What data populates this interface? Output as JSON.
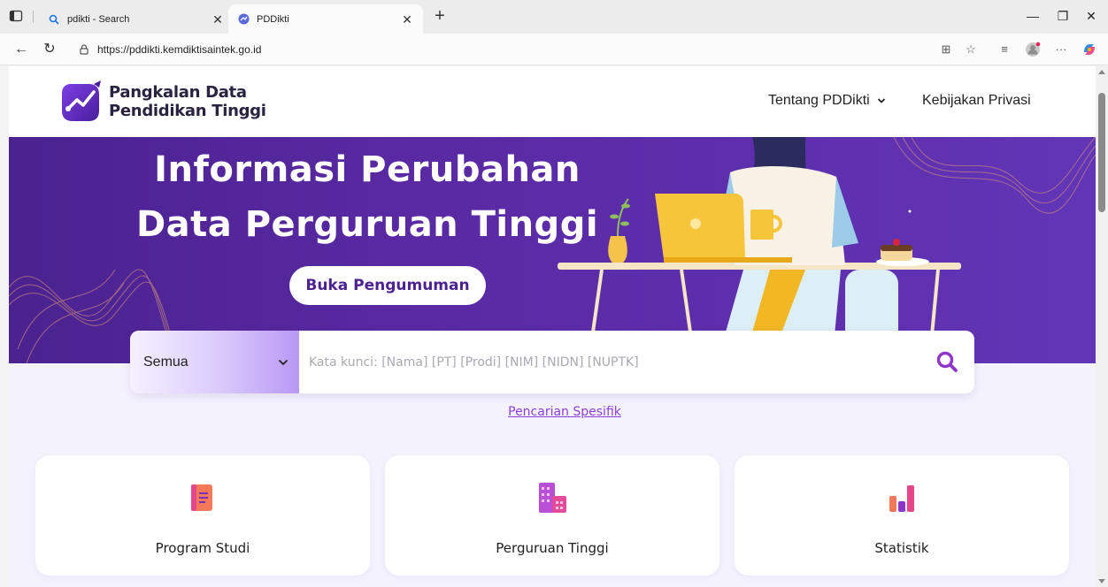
{
  "browser": {
    "tabs": [
      {
        "title": "pdikti - Search"
      },
      {
        "title": "PDDikti"
      }
    ],
    "url": "https://pddikti.kemdiktisaintek.go.id"
  },
  "header": {
    "logo_line1": "Pangkalan Data",
    "logo_line2": "Pendidikan Tinggi",
    "nav": [
      {
        "label": "Tentang PDDikti"
      },
      {
        "label": "Kebijakan Privasi"
      }
    ]
  },
  "hero": {
    "title_line1": "Informasi Perubahan",
    "title_line2": "Data Perguruan Tinggi",
    "button_label": "Buka Pengumuman"
  },
  "search": {
    "category": "Semua",
    "placeholder": "Kata kunci: [Nama] [PT] [Prodi] [NIM] [NIDN] [NUPTK]"
  },
  "specific_search_link": "Pencarian Spesifik",
  "cards": [
    {
      "label": "Program Studi",
      "icon": "book-icon"
    },
    {
      "label": "Perguruan Tinggi",
      "icon": "building-icon"
    },
    {
      "label": "Statistik",
      "icon": "bar-chart-icon"
    }
  ],
  "colors": {
    "brand_purple": "#5a2aa4",
    "link_purple": "#8b3fd9",
    "page_bg": "#f4f2fd"
  }
}
